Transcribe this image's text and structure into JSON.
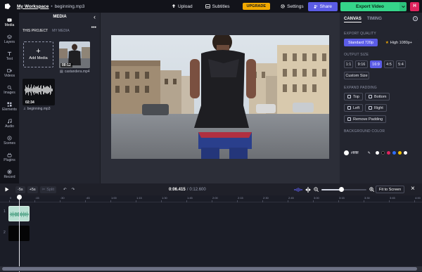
{
  "topbar": {
    "breadcrumb_workspace": "My Workspace",
    "breadcrumb_separator": "•",
    "project_name": "beginning.mp3",
    "upload_label": "Upload",
    "subtitles_label": "Subtitles",
    "upgrade_label": "UPGRADE",
    "settings_label": "Settings",
    "share_label": "Share",
    "export_label": "Export Video",
    "avatar_initial": "H"
  },
  "rail": {
    "items": [
      {
        "label": "Media",
        "icon": "media-icon"
      },
      {
        "label": "Layers",
        "icon": "layers-icon"
      },
      {
        "label": "Text",
        "icon": "text-icon"
      },
      {
        "label": "Videos",
        "icon": "videos-icon"
      },
      {
        "label": "Images",
        "icon": "images-icon"
      },
      {
        "label": "Elements",
        "icon": "elements-icon"
      },
      {
        "label": "Audio",
        "icon": "audio-icon"
      },
      {
        "label": "Scenes",
        "icon": "scenes-icon"
      },
      {
        "label": "Plugins",
        "icon": "plugins-icon"
      },
      {
        "label": "Record",
        "icon": "record-icon"
      }
    ]
  },
  "media": {
    "title": "MEDIA",
    "tabs": [
      "THIS PROJECT",
      "MY MEDIA"
    ],
    "add_label": "Add Media",
    "items": [
      {
        "name": "castandera.mp4",
        "duration": "00:12"
      },
      {
        "name": "beginning.mp3",
        "duration": "02:34"
      }
    ]
  },
  "rpanel": {
    "tabs": [
      "CANVAS",
      "TIMING"
    ],
    "help": "?",
    "export_quality_label": "EXPORT QUALITY",
    "quality_options": [
      "Standard 720p",
      "High 1080p+"
    ],
    "output_size_label": "OUTPUT SIZE",
    "sizes": [
      "1:1",
      "9:16",
      "16:9",
      "4:5",
      "5:4"
    ],
    "custom_size": "Custom Size",
    "expand_padding_label": "EXPAND PADDING",
    "padding": [
      "Top",
      "Bottom",
      "Left",
      "Right"
    ],
    "remove_padding": "Remove Padding",
    "bg_color_label": "BACKGROUND COLOR",
    "bg_hex": "#ffffff",
    "swatches": [
      "#ffffff",
      "#000000",
      "#e0245e",
      "#2f6df6",
      "#f2c200",
      "#ffffff"
    ]
  },
  "controls": {
    "back5": "-5s",
    "fwd5": "+5s",
    "split": "Split",
    "current_time": "0:06.415",
    "separator": "/",
    "total_time": "0:12.600",
    "fit_label": "Fit to Screen",
    "zoom_level": 0.45
  },
  "timeline": {
    "ticks": [
      "0",
      ":15",
      ":30",
      ":45",
      "1:00",
      "1:15",
      "1:30",
      "1:45",
      "2:00",
      "2:15",
      "2:30",
      "2:45",
      "3:00",
      "3:15",
      "3:30",
      "3:45",
      "4:00"
    ],
    "tracks": [
      "1",
      "2"
    ]
  },
  "colors": {
    "accent": "#5b5ce6",
    "export": "#35d58a",
    "upgrade": "#f2a900"
  }
}
